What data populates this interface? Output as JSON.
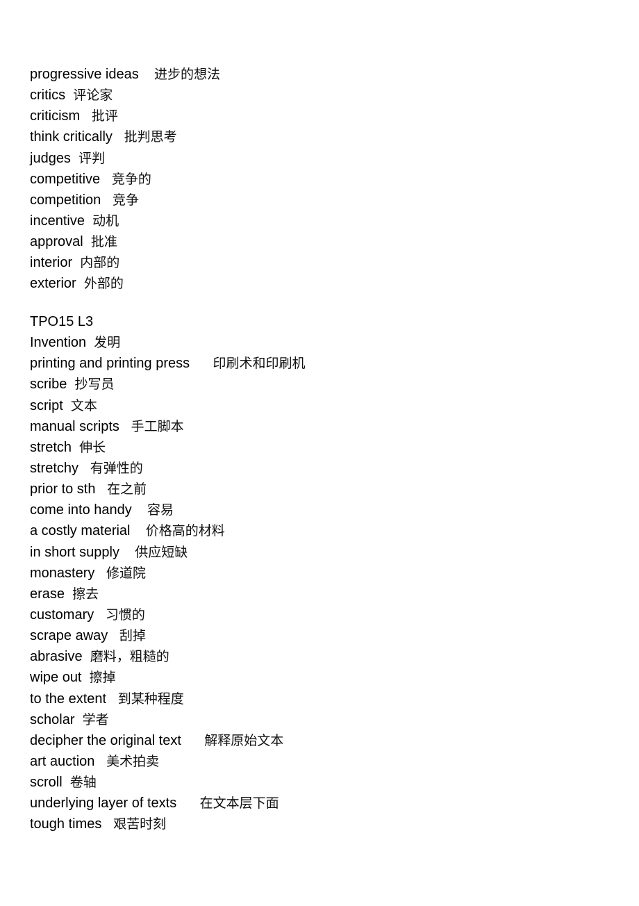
{
  "section1": {
    "entries": [
      {
        "en": "progressive ideas",
        "sep": "    ",
        "zh": "进步的想法"
      },
      {
        "en": "critics",
        "sep": "  ",
        "zh": "评论家"
      },
      {
        "en": "criticism",
        "sep": "   ",
        "zh": "批评"
      },
      {
        "en": "think critically",
        "sep": "   ",
        "zh": "批判思考"
      },
      {
        "en": "judges",
        "sep": "  ",
        "zh": "评判"
      },
      {
        "en": "competitive",
        "sep": "   ",
        "zh": "竞争的"
      },
      {
        "en": "competition",
        "sep": "   ",
        "zh": "竞争"
      },
      {
        "en": "incentive",
        "sep": "  ",
        "zh": "动机"
      },
      {
        "en": "approval",
        "sep": "  ",
        "zh": "批准"
      },
      {
        "en": "interior",
        "sep": "  ",
        "zh": "内部的"
      },
      {
        "en": "exterior",
        "sep": "  ",
        "zh": "外部的"
      }
    ]
  },
  "section2": {
    "heading": "TPO15 L3",
    "entries": [
      {
        "en": "Invention",
        "sep": "  ",
        "zh": "发明"
      },
      {
        "en": "printing and printing press",
        "sep": "      ",
        "zh": "印刷术和印刷机"
      },
      {
        "en": "scribe",
        "sep": "  ",
        "zh": "抄写员"
      },
      {
        "en": "script",
        "sep": "  ",
        "zh": "文本"
      },
      {
        "en": "manual scripts",
        "sep": "   ",
        "zh": "手工脚本"
      },
      {
        "en": "stretch",
        "sep": "  ",
        "zh": "伸长"
      },
      {
        "en": "stretchy",
        "sep": "   ",
        "zh": "有弹性的"
      },
      {
        "en": "prior to sth",
        "sep": "   ",
        "zh": "在之前"
      },
      {
        "en": "come into handy",
        "sep": "    ",
        "zh": "容易"
      },
      {
        "en": "a costly material",
        "sep": "    ",
        "zh": "价格高的材料"
      },
      {
        "en": "in short supply",
        "sep": "    ",
        "zh": "供应短缺"
      },
      {
        "en": "monastery",
        "sep": "   ",
        "zh": "修道院"
      },
      {
        "en": "erase",
        "sep": "  ",
        "zh": "擦去"
      },
      {
        "en": "customary",
        "sep": "   ",
        "zh": "习惯的"
      },
      {
        "en": "scrape away",
        "sep": "   ",
        "zh": "刮掉"
      },
      {
        "en": "abrasive",
        "sep": "  ",
        "zh": "磨料，粗糙的"
      },
      {
        "en": "wipe out",
        "sep": "  ",
        "zh": "擦掉"
      },
      {
        "en": "to the extent",
        "sep": "   ",
        "zh": "到某种程度"
      },
      {
        "en": "scholar",
        "sep": "  ",
        "zh": "学者"
      },
      {
        "en": "decipher the original text",
        "sep": "      ",
        "zh": "解释原始文本"
      },
      {
        "en": "art auction",
        "sep": "   ",
        "zh": "美术拍卖"
      },
      {
        "en": "scroll",
        "sep": "  ",
        "zh": "卷轴"
      },
      {
        "en": "underlying layer of texts",
        "sep": "      ",
        "zh": "在文本层下面"
      },
      {
        "en": "tough times",
        "sep": "   ",
        "zh": "艰苦时刻"
      }
    ]
  }
}
